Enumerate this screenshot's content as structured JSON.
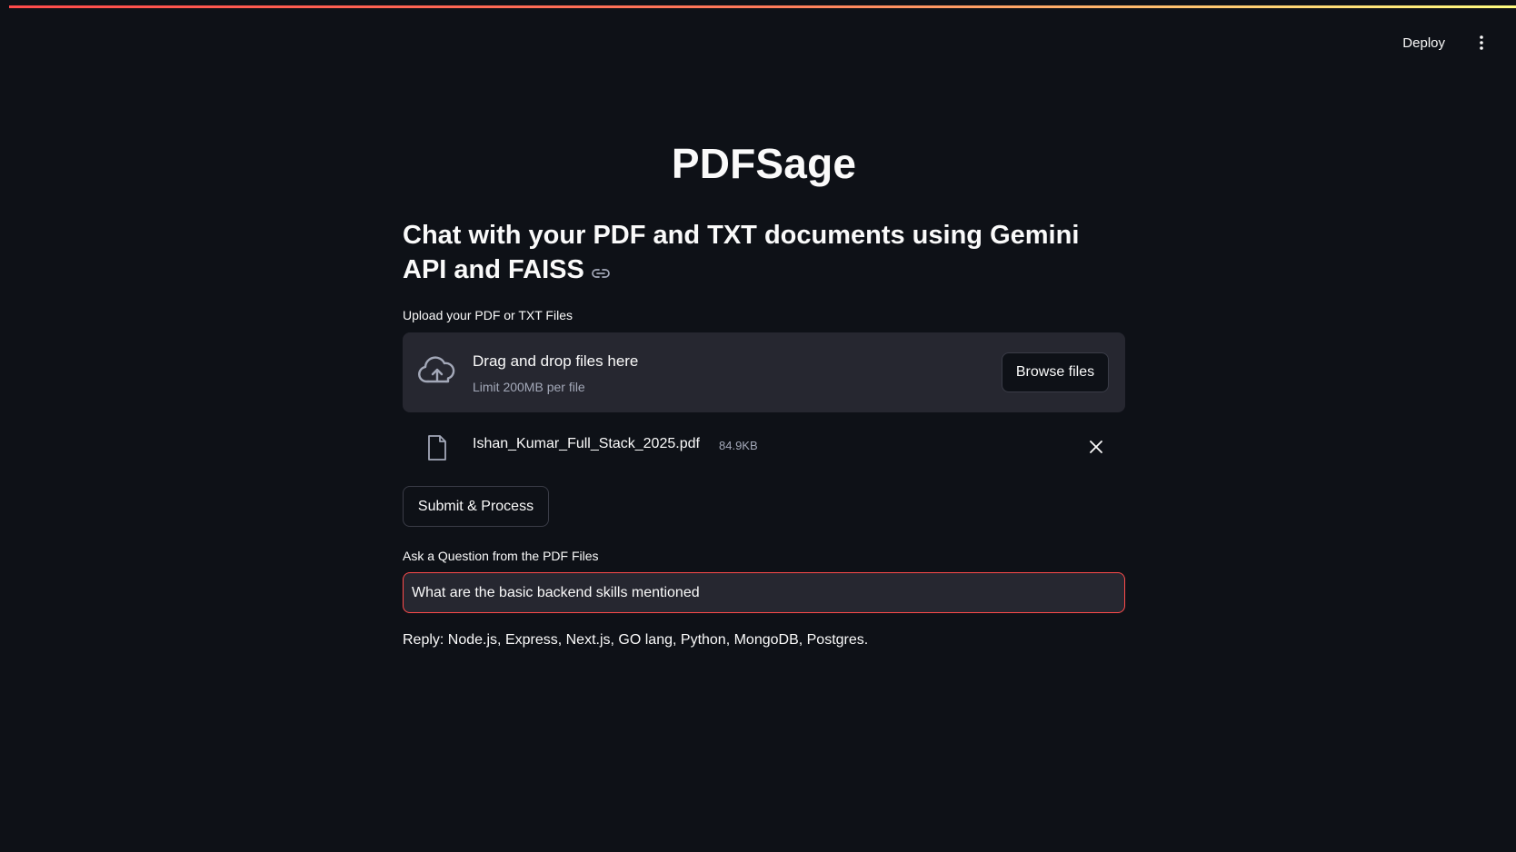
{
  "header": {
    "deploy_label": "Deploy",
    "menu_icon": "vertical-ellipsis-icon"
  },
  "main": {
    "title": "PDFSage",
    "subtitle": "Chat with your PDF and TXT documents using Gemini API and FAISS",
    "subtitle_link_icon": "link-icon"
  },
  "uploader": {
    "label": "Upload your PDF or TXT Files",
    "drop_text": "Drag and drop files here",
    "limit_text": "Limit 200MB per file",
    "browse_label": "Browse files",
    "icon": "cloud-upload-icon"
  },
  "uploaded_file": {
    "name": "Ishan_Kumar_Full_Stack_2025.pdf",
    "size": "84.9KB",
    "icon": "file-icon",
    "remove_icon": "close-icon"
  },
  "submit_label": "Submit & Process",
  "question": {
    "label": "Ask a Question from the PDF Files",
    "value": "What are the basic backend skills mentioned"
  },
  "reply": "Reply: Node.js, Express, Next.js, GO lang, Python, MongoDB, Postgres.",
  "colors": {
    "background": "#0e1117",
    "panel": "#262730",
    "accent": "#ff4b4b",
    "muted_text": "#a3a8b8"
  }
}
